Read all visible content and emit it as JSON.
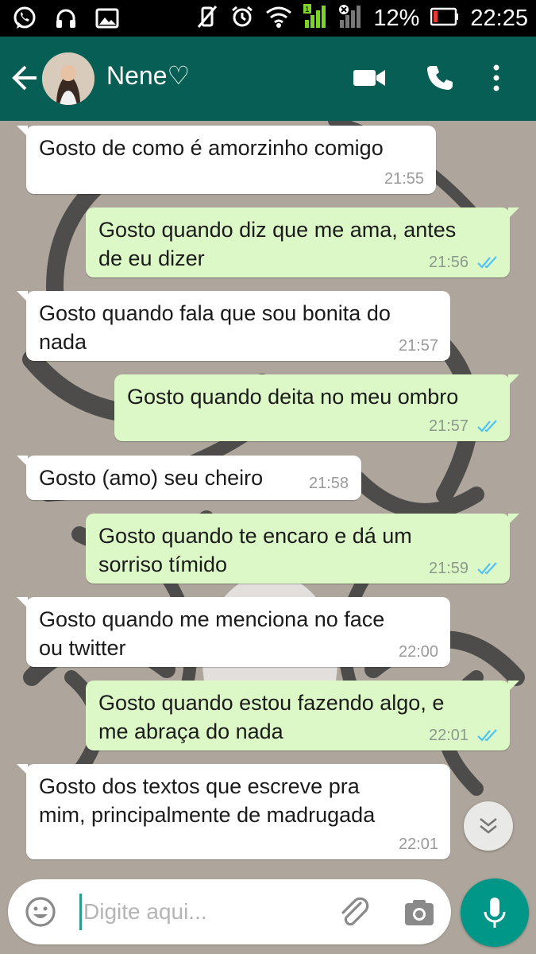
{
  "status_bar": {
    "battery": "12%",
    "time": "22:25",
    "signal_badge": "1"
  },
  "header": {
    "contact_name": "Nene♡",
    "color": "#075e54"
  },
  "messages": [
    {
      "direction": "in",
      "text_lines": [
        "Gosto de como é amorzinho comigo"
      ],
      "time": "21:55"
    },
    {
      "direction": "out",
      "text_lines": [
        "Gosto quando diz que me ama, antes",
        "de eu dizer"
      ],
      "time": "21:56",
      "status": "read"
    },
    {
      "direction": "in",
      "text_lines": [
        "Gosto quando fala que sou bonita do",
        "nada"
      ],
      "time": "21:57"
    },
    {
      "direction": "out",
      "text_lines": [
        "Gosto quando deita no meu ombro"
      ],
      "time": "21:57",
      "status": "read"
    },
    {
      "direction": "in",
      "text_lines": [
        "Gosto (amo) seu cheiro"
      ],
      "time": "21:58"
    },
    {
      "direction": "out",
      "text_lines": [
        "Gosto quando te encaro e dá um",
        "sorriso tímido"
      ],
      "time": "21:59",
      "status": "read"
    },
    {
      "direction": "in",
      "text_lines": [
        "Gosto quando me menciona no face",
        "ou twitter"
      ],
      "time": "22:00"
    },
    {
      "direction": "out",
      "text_lines": [
        "Gosto quando estou fazendo algo, e",
        "me abraça do nada"
      ],
      "time": "22:01",
      "status": "read"
    },
    {
      "direction": "in",
      "text_lines": [
        "Gosto dos textos que escreve pra",
        "mim, principalmente de madrugada"
      ],
      "time": "22:01"
    }
  ],
  "composer": {
    "placeholder": "Digite aqui...",
    "value": ""
  },
  "colors": {
    "outgoing_bubble": "#dcf8c6",
    "incoming_bubble": "#ffffff",
    "read_ticks": "#4fc3f7",
    "mic_button": "#009688"
  }
}
